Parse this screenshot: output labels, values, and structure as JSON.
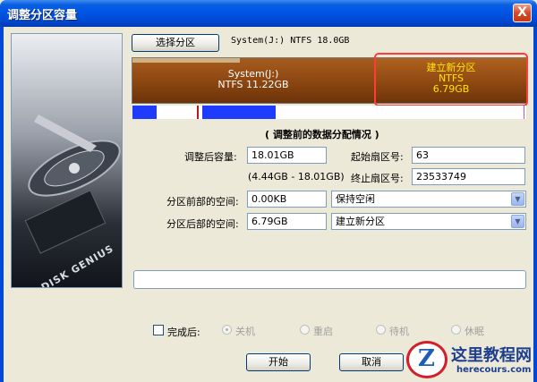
{
  "window": {
    "title": "调整分区容量",
    "close_label": "X"
  },
  "side_panel": {
    "logo_text": "DISK GENIUS"
  },
  "partition_select": {
    "button_label": "选择分区",
    "info": "System(J:) NTFS 18.0GB"
  },
  "disk_map": {
    "segments": [
      {
        "name": "System(J:)",
        "fs": "NTFS",
        "size": "11.22GB"
      },
      {
        "name": "建立新分区",
        "fs": "NTFS",
        "size": "6.79GB"
      }
    ]
  },
  "section_title": "( 调整前的数据分配情况 )",
  "form": {
    "new_size_label": "调整后容量:",
    "new_size_value": "18.01GB",
    "new_size_range": "(4.44GB - 18.01GB)",
    "start_sector_label": "起始扇区号:",
    "start_sector_value": "63",
    "end_sector_label": "终止扇区号:",
    "end_sector_value": "23533749",
    "before_space_label": "分区前部的空间:",
    "before_space_value": "0.00KB",
    "before_space_action": "保持空闲",
    "after_space_label": "分区后部的空间:",
    "after_space_value": "6.79GB",
    "after_space_action": "建立新分区"
  },
  "completion": {
    "checkbox_label": "完成后:",
    "options": [
      "关机",
      "重启",
      "待机",
      "休眠"
    ]
  },
  "buttons": {
    "start": "开始",
    "cancel": "取消"
  },
  "watermark": {
    "title": "这里教程网",
    "url": "herecours.com",
    "logo_letter": "Z"
  },
  "colors": {
    "title_bar": "#0055e5",
    "partition_fill": "#8b4510",
    "highlight_border": "#ff3b3b",
    "map_blue": "#1e3cff"
  }
}
